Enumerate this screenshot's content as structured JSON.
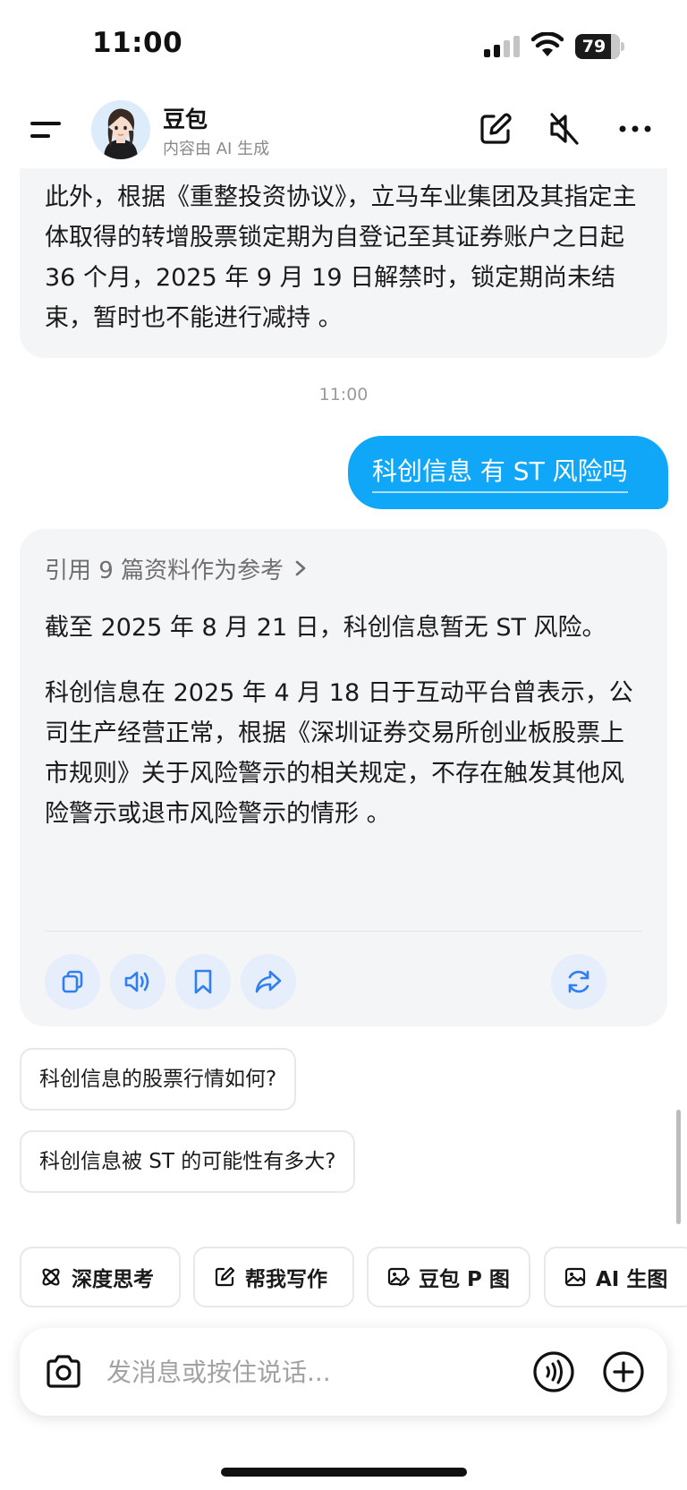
{
  "status_bar": {
    "time": "11:00",
    "battery": "79",
    "battery_level": 0.79
  },
  "header": {
    "bot_name": "豆包",
    "subtitle": "内容由 AI 生成",
    "icons": [
      "menu-icon",
      "edit-icon",
      "mute-speaker-icon",
      "more-icon"
    ]
  },
  "messages": {
    "previous_answer_tail": "此外，根据《重整投资协议》，立马车业集团及其指定主体取得的转增股票锁定期为自登记至其证券账户之日起 36 个月，2025 年 9 月 19 日解禁时，锁定期尚未结束，暂时也不能进行减持 。",
    "timestamp": "11:00",
    "user_message": "科创信息 有 ST 风险吗",
    "answer": {
      "references": "引用 9 篇资料作为参考",
      "paragraph1": "截至 2025 年 8 月 21 日，科创信息暂无 ST 风险。",
      "paragraph2": "科创信息在 2025 年 4 月 18 日于互动平台曾表示，公司生产经营正常，根据《深圳证券交易所创业板股票上市规则》关于风险警示的相关规定，不存在触发其他风险警示或退市风险警示的情形 。",
      "actions": [
        "copy-icon",
        "speaker-icon",
        "bookmark-icon",
        "share-icon",
        "regenerate-icon"
      ]
    }
  },
  "suggestions": [
    "科创信息的股票行情如何?",
    "科创信息被 ST 的可能性有多大?"
  ],
  "quick_actions": [
    {
      "label": "深度思考",
      "icon": "atom-icon"
    },
    {
      "label": "帮我写作",
      "icon": "write-icon"
    },
    {
      "label": "豆包 P 图",
      "icon": "image-edit-icon"
    },
    {
      "label": "AI 生图",
      "icon": "image-icon"
    }
  ],
  "composer": {
    "placeholder": "发消息或按住说话..."
  },
  "colors": {
    "accent": "#11a7f8",
    "action_icon": "#2f7ff0",
    "bubble_bg": "#f4f5f7"
  }
}
